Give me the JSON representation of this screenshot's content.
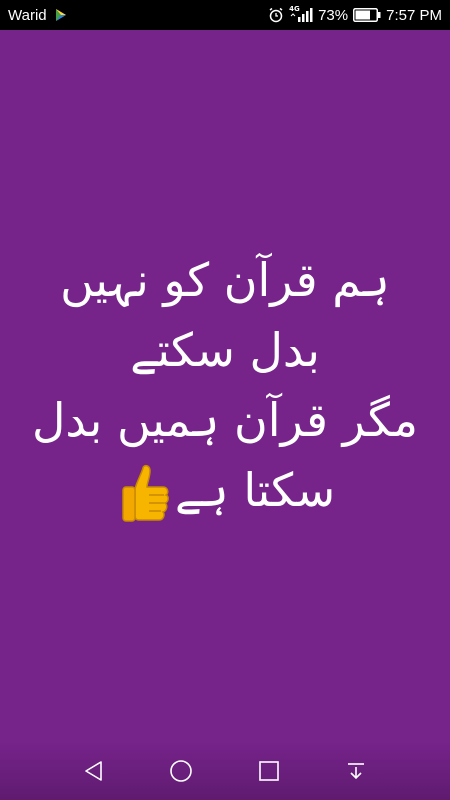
{
  "status_bar": {
    "carrier": "Warid",
    "network_type": "4G",
    "battery_percent": "73%",
    "time": "7:57 PM",
    "icons": [
      "carrier-app-icon",
      "alarm-icon",
      "signal-icon",
      "battery-icon"
    ]
  },
  "message": {
    "lines": [
      "ہم قرآن کو نہیں",
      "بدل سکتے",
      "مگر قرآن ہمیں بدل",
      "سکتا ہے"
    ],
    "emoji": "thumbs-up"
  },
  "nav_bar": {
    "buttons": [
      "back-icon",
      "home-icon",
      "recents-icon",
      "notification-pull-icon"
    ]
  },
  "colors": {
    "background": "#76238a",
    "status_bar": "#000000",
    "text": "#ffffff"
  }
}
